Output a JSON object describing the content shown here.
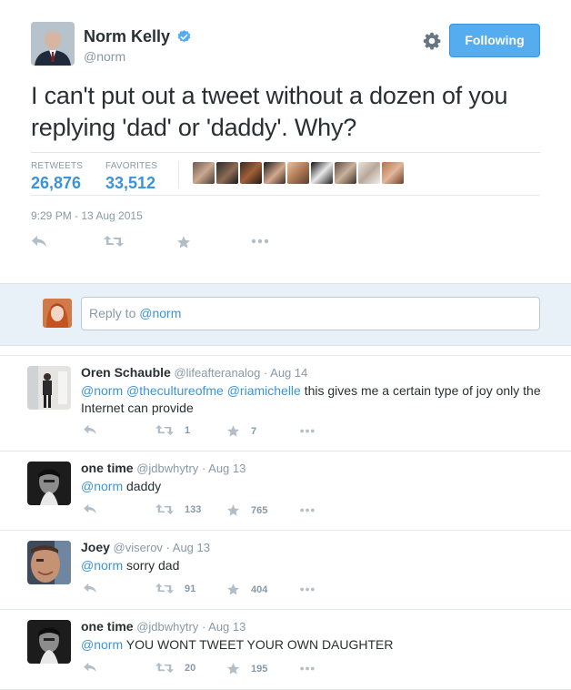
{
  "author": {
    "name": "Norm Kelly",
    "handle": "@norm",
    "follow_label": "Following"
  },
  "tweet": {
    "text": "I can't put out a tweet without a dozen of you replying 'dad' or 'daddy'. Why?",
    "retweets_label": "RETWEETS",
    "retweets": "26,876",
    "favorites_label": "FAVORITES",
    "favorites": "33,512",
    "timestamp": "9:29 PM - 13 Aug 2015"
  },
  "reply_box": {
    "prefix": "Reply to ",
    "mention": "@norm"
  },
  "replies": [
    {
      "name": "Oren Schauble",
      "handle": "@lifeafteranalog",
      "date": "· Aug 14",
      "mentions": "@norm @thecultureofme @riamichelle",
      "text": " this gives me a certain type of joy only the Internet can provide",
      "retweets": "1",
      "favorites": "7"
    },
    {
      "name": "one time",
      "handle": "@jdbwhytry",
      "date": "· Aug 13",
      "mentions": "@norm",
      "text": " daddy",
      "retweets": "133",
      "favorites": "765"
    },
    {
      "name": "Joey",
      "handle": "@viserov",
      "date": "· Aug 13",
      "mentions": "@norm",
      "text": " sorry dad",
      "retweets": "91",
      "favorites": "404"
    },
    {
      "name": "one time",
      "handle": "@jdbwhytry",
      "date": "· Aug 13",
      "mentions": "@norm",
      "text": " YOU WONT TWEET YOUR OWN DAUGHTER",
      "retweets": "20",
      "favorites": "195"
    }
  ],
  "colors": {
    "accent": "#55acee",
    "link": "#3b94d9",
    "muted": "#8899a6",
    "text": "#292f33",
    "reply_bg": "#e8f1f8"
  },
  "icons": {
    "verified": "verified-badge-icon",
    "gear": "gear-icon",
    "reply": "reply-icon",
    "retweet": "retweet-icon",
    "favorite": "star-icon",
    "more": "more-dots-icon"
  }
}
